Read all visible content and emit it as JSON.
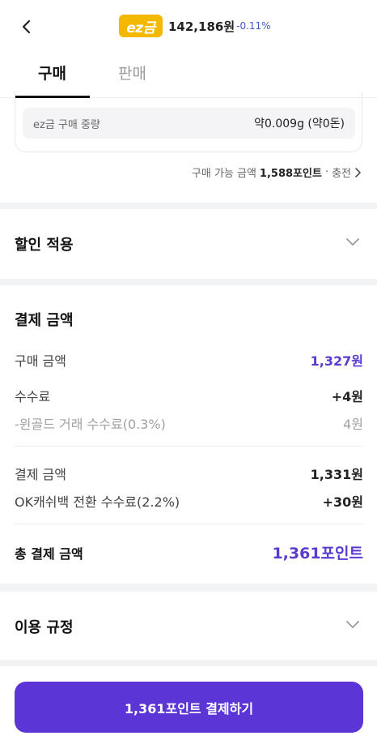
{
  "header": {
    "logo_text": "ez금",
    "price": "142,186원",
    "change": "-0.11%",
    "colors": {
      "logo": "#f5b800",
      "change": "#3e5ac9"
    }
  },
  "tabs": [
    {
      "label": "구매",
      "active": true
    },
    {
      "label": "판매",
      "active": false
    }
  ],
  "purchase": {
    "weight_label": "ez금 구매 중량",
    "weight_value": "약0.009g (약0돈)",
    "available_label": "구매 가능 금액",
    "available_value": "1,588포인트",
    "separator": "·",
    "charge_label": "충전"
  },
  "discount": {
    "title": "할인 적용"
  },
  "payment": {
    "title": "결제 금액",
    "rows": [
      {
        "label": "구매 금액",
        "value": "1,327원"
      },
      {
        "label": "수수료",
        "value": "+4원"
      },
      {
        "label": "-윈골드 거래 수수료(0.3%)",
        "value": "4원"
      },
      {
        "label": "결제 금액",
        "value": "1,331원"
      },
      {
        "label": "OK캐쉬백 전환 수수료(2.2%)",
        "value": "+30원"
      }
    ],
    "total_label": "총 결제 금액",
    "total_value": "1,361포인트"
  },
  "terms": {
    "title": "이용 규정"
  },
  "pay_button": {
    "label": "1,361포인트 결제하기",
    "color": "#5b35d5"
  },
  "icons": [
    "back-icon",
    "chevron-right-icon",
    "chevron-down-icon"
  ]
}
